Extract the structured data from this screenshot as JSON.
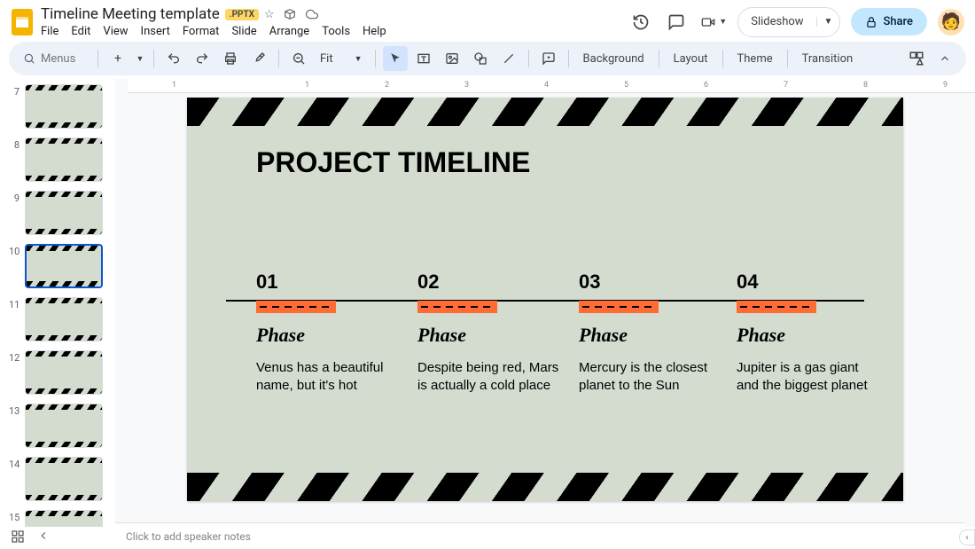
{
  "header": {
    "doc_title": "Timeline Meeting template",
    "badge": ".PPTX",
    "menus": [
      "File",
      "Edit",
      "View",
      "Insert",
      "Format",
      "Slide",
      "Arrange",
      "Tools",
      "Help"
    ],
    "slideshow_label": "Slideshow",
    "share_label": "Share"
  },
  "toolbar": {
    "search_placeholder": "Menus",
    "zoom_label": "Fit",
    "buttons": {
      "background": "Background",
      "layout": "Layout",
      "theme": "Theme",
      "transition": "Transition"
    }
  },
  "ruler_ticks": [
    "1",
    "",
    "1",
    "2",
    "3",
    "4",
    "5",
    "6",
    "7",
    "8",
    "9"
  ],
  "thumbnails": [
    {
      "num": "7"
    },
    {
      "num": "8"
    },
    {
      "num": "9"
    },
    {
      "num": "10",
      "selected": true
    },
    {
      "num": "11"
    },
    {
      "num": "12"
    },
    {
      "num": "13"
    },
    {
      "num": "14"
    },
    {
      "num": "15"
    }
  ],
  "slide": {
    "title": "PROJECT TIMELINE",
    "phases": [
      {
        "num": "01",
        "label": "Phase",
        "desc": "Venus has a beautiful name, but it's hot"
      },
      {
        "num": "02",
        "label": "Phase",
        "desc": "Despite being red, Mars is actually a cold place"
      },
      {
        "num": "03",
        "label": "Phase",
        "desc": "Mercury is the closest planet to the Sun"
      },
      {
        "num": "04",
        "label": "Phase",
        "desc": "Jupiter is a gas giant and the biggest planet"
      }
    ]
  },
  "notes_placeholder": "Click to add speaker notes"
}
